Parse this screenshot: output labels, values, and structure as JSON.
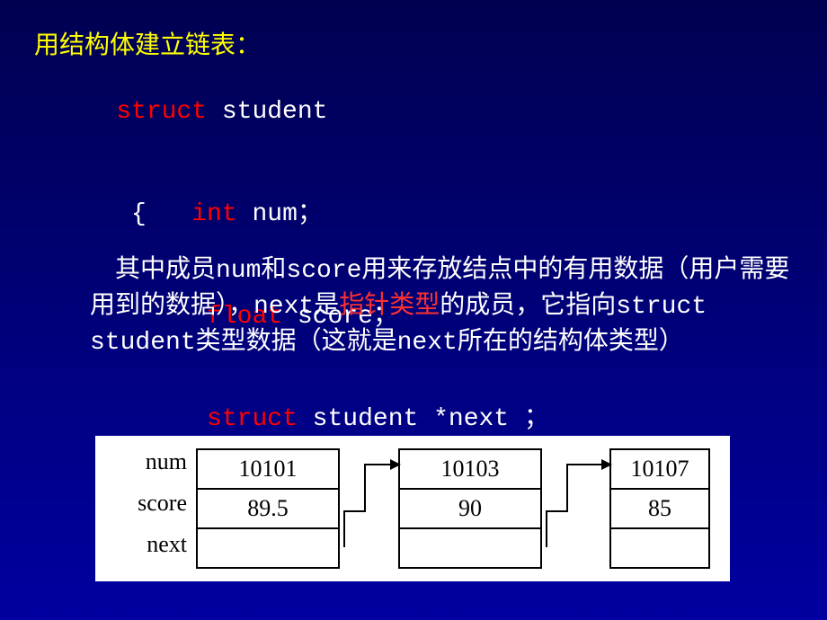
{
  "title": "用结构体建立链表：",
  "code": {
    "line1_kw": "struct",
    "line1_rest": " student",
    "line2_brace": " {",
    "line2_kw": "int",
    "line2_rest": " num；",
    "line3_kw": "float",
    "line3_rest": " score；",
    "line4_kw": "struct",
    "line4_rest": " student *next ；",
    "line5": " }；"
  },
  "paragraph": {
    "part1": "其中成员num和score用来存放结点中的有用数据（用户需要用到的数据），next是",
    "highlight": "指针类型",
    "part2": "的成员，它指向struct student类型数据（这就是next所在的结构体类型）"
  },
  "diagram": {
    "labels": {
      "num": "num",
      "score": "score",
      "next": "next"
    },
    "nodes": [
      {
        "num": "10101",
        "score": "89.5"
      },
      {
        "num": "10103",
        "score": "90"
      },
      {
        "num": "10107",
        "score": "85"
      }
    ]
  }
}
